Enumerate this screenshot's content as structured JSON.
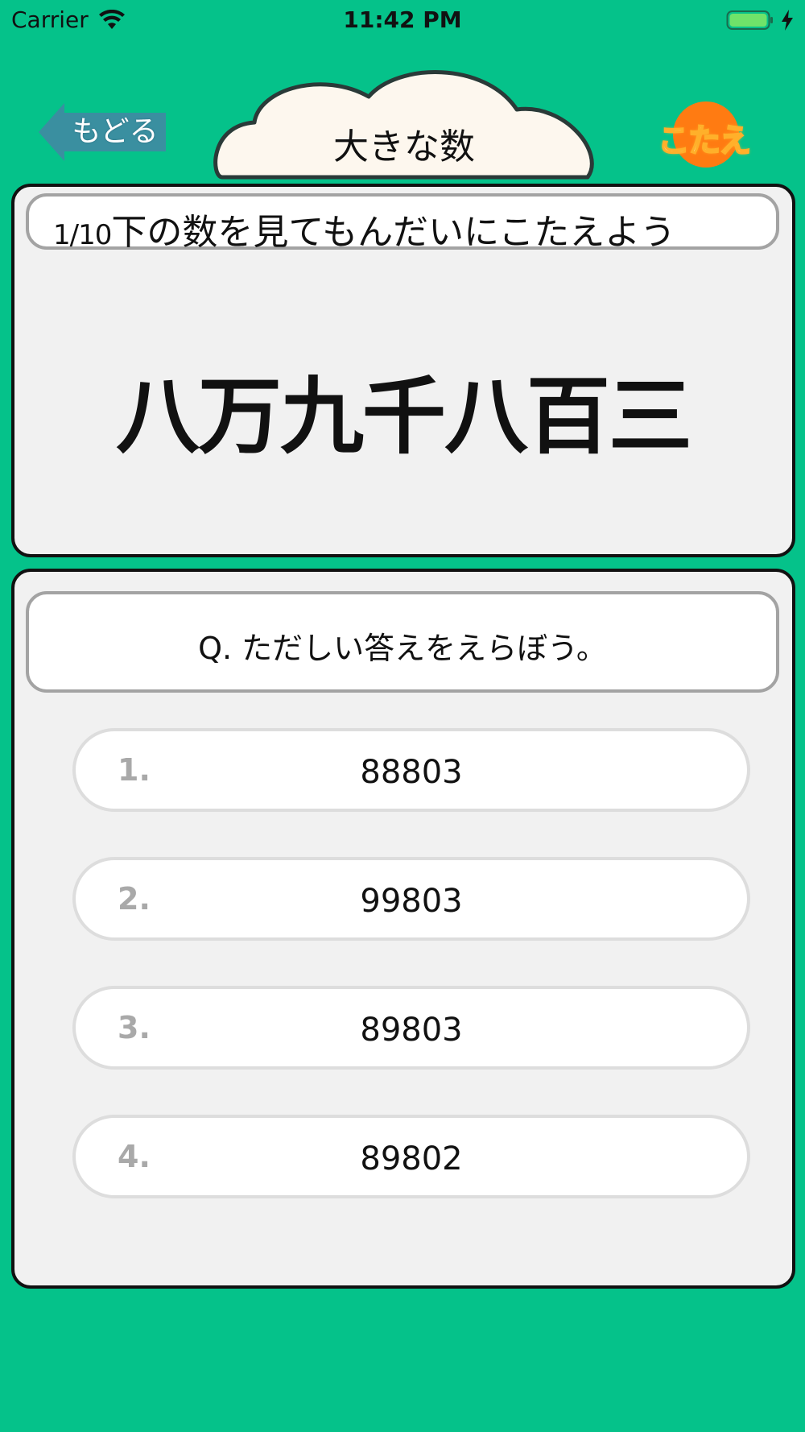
{
  "status_bar": {
    "carrier": "Carrier",
    "time": "11:42 PM",
    "battery_color": "#6fe36a"
  },
  "header": {
    "back_label": "もどる",
    "title": "大きな数",
    "answer_label": "こたえ"
  },
  "question": {
    "counter": "1/10",
    "instruction": "下の数を見てもんだいにこたえよう",
    "number_text": "八万九千八百三"
  },
  "prompt": "Q. ただしい答えをえらぼう。",
  "choices": [
    {
      "index": "1.",
      "value": "88803"
    },
    {
      "index": "2.",
      "value": "99803"
    },
    {
      "index": "3.",
      "value": "89803"
    },
    {
      "index": "4.",
      "value": "89802"
    }
  ],
  "colors": {
    "background": "#05c28a",
    "back_button": "#3a8fa0",
    "answer_button": "#ff7b12",
    "cloud_fill": "#fdf7ee",
    "panel": "#f1f1f1"
  }
}
